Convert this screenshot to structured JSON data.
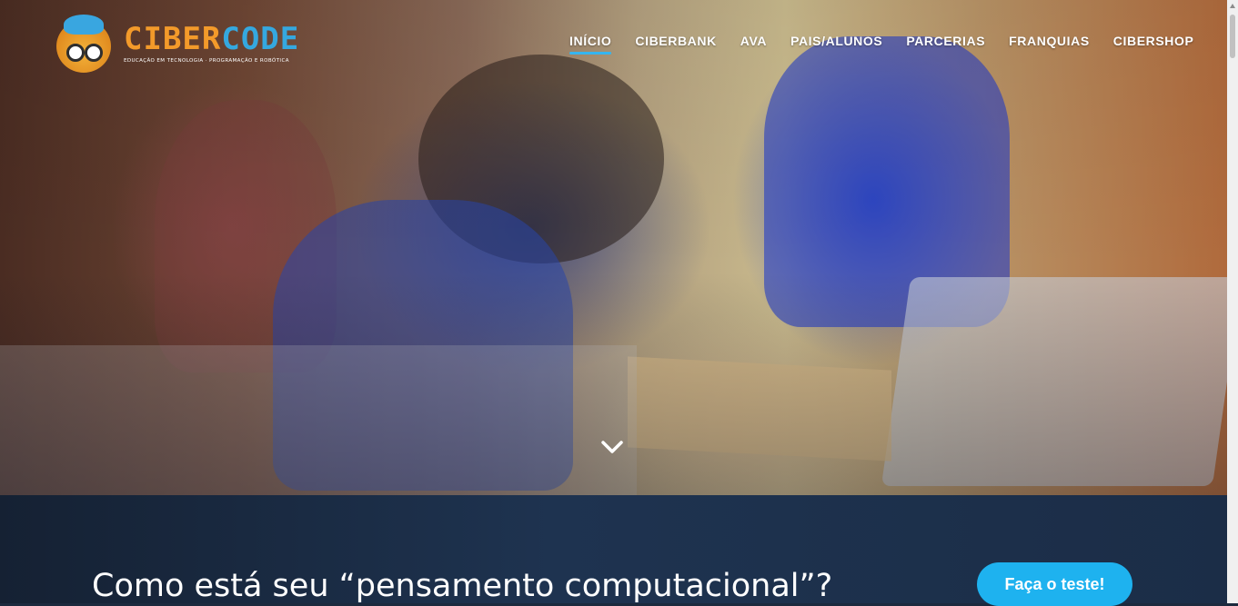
{
  "brand": {
    "name_part1": "CIBER",
    "name_part2": "CODE",
    "tagline": "EDUCAÇÃO EM TECNOLOGIA · PROGRAMAÇÃO E ROBÓTICA",
    "colors": {
      "orange": "#f39a2a",
      "blue": "#35a8df"
    }
  },
  "nav": {
    "items": [
      {
        "label": "INÍCIO",
        "active": true
      },
      {
        "label": "CIBERBANK",
        "active": false
      },
      {
        "label": "AVA",
        "active": false
      },
      {
        "label": "PAIS/ALUNOS",
        "active": false
      },
      {
        "label": "PARCERIAS",
        "active": false
      },
      {
        "label": "FRANQUIAS",
        "active": false
      },
      {
        "label": "CIBERSHOP",
        "active": false
      }
    ],
    "active_indicator_color": "#35b5ef"
  },
  "hero": {
    "scroll_icon": "chevron-down-icon"
  },
  "cta": {
    "text": "Como está seu “pensamento computacional”?",
    "button_label": "Faça o teste!",
    "button_color": "#1eb2ef"
  }
}
